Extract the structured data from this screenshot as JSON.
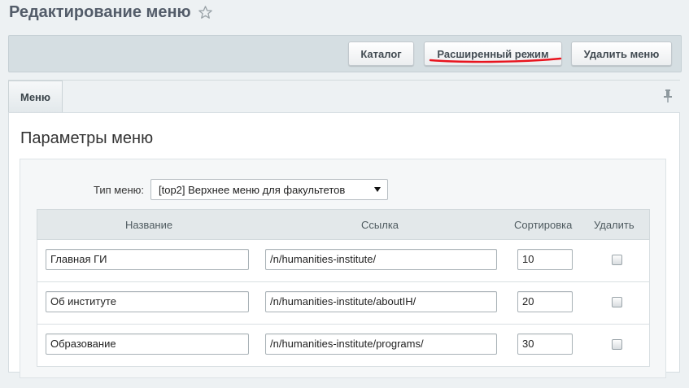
{
  "page": {
    "title": "Редактирование меню",
    "star_icon": "star-icon"
  },
  "toolbar": {
    "catalog_label": "Каталог",
    "advanced_label": "Расширенный режим",
    "delete_label": "Удалить меню",
    "annotation_color": "#e8141e"
  },
  "tabs": {
    "menu_label": "Меню",
    "pin_icon": "pin-icon"
  },
  "section": {
    "title": "Параметры меню"
  },
  "menu_type": {
    "label": "Тип меню:",
    "selected": "[top2] Верхнее меню для факультетов"
  },
  "table": {
    "headers": {
      "name": "Название",
      "link": "Ссылка",
      "sort": "Сортировка",
      "delete": "Удалить"
    },
    "rows": [
      {
        "name": "Главная ГИ",
        "link": "/n/humanities-institute/",
        "sort": "10",
        "delete": false
      },
      {
        "name": "Об институте",
        "link": "/n/humanities-institute/aboutIH/",
        "sort": "20",
        "delete": false
      },
      {
        "name": "Образование",
        "link": "/n/humanities-institute/programs/",
        "sort": "30",
        "delete": false
      }
    ]
  }
}
